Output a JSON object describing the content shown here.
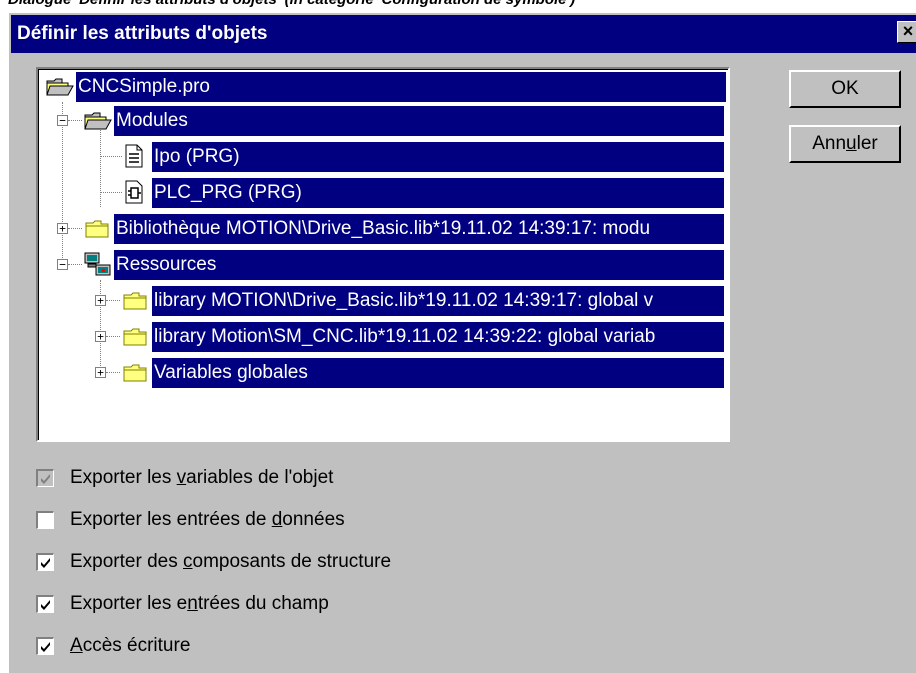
{
  "caption": "Dialogue 'Définir les attributs d'objets' (in catégorie 'Configuration de symbole')",
  "dialog": {
    "title": "Définir les attributs d'objets",
    "close_glyph": "×"
  },
  "tree": {
    "root": "CNCSimple.pro",
    "modules": "Modules",
    "ipo": "Ipo (PRG)",
    "plc_prg": "PLC_PRG (PRG)",
    "library": "Bibliothèque MOTION\\Drive_Basic.lib*19.11.02 14:39:17: modu",
    "resources": "Ressources",
    "res_lib1": "library MOTION\\Drive_Basic.lib*19.11.02 14:39:17: global v",
    "res_lib2": "library Motion\\SM_CNC.lib*19.11.02 14:39:22: global variab",
    "globals": "Variables globales",
    "expander_plus": "+",
    "expander_minus": "−"
  },
  "buttons": {
    "ok": "OK",
    "cancel_pre": "Ann",
    "cancel_mn": "u",
    "cancel_post": "ler"
  },
  "checkboxes": [
    {
      "pre": "Exporter les ",
      "mn": "v",
      "post": "ariables de l'objet",
      "checked": true,
      "disabled": true
    },
    {
      "pre": "Exporter les entrées de ",
      "mn": "d",
      "post": "onnées",
      "checked": false,
      "disabled": false
    },
    {
      "pre": "Exporter des ",
      "mn": "c",
      "post": "omposants de structure",
      "checked": true,
      "disabled": false
    },
    {
      "pre": "Exporter les e",
      "mn": "n",
      "post": "trées du champ",
      "checked": true,
      "disabled": false
    },
    {
      "pre": "",
      "mn": "A",
      "post": "ccès écriture",
      "checked": true,
      "disabled": false
    }
  ],
  "colors": {
    "titlebar": "#000080",
    "selection": "#000080",
    "dialog_bg": "#c0c0c0"
  },
  "icons": {
    "open_folder": "open-folder-icon",
    "folder": "folder-icon",
    "document": "document-icon",
    "function_block": "function-block-icon",
    "resources": "resources-icon"
  }
}
